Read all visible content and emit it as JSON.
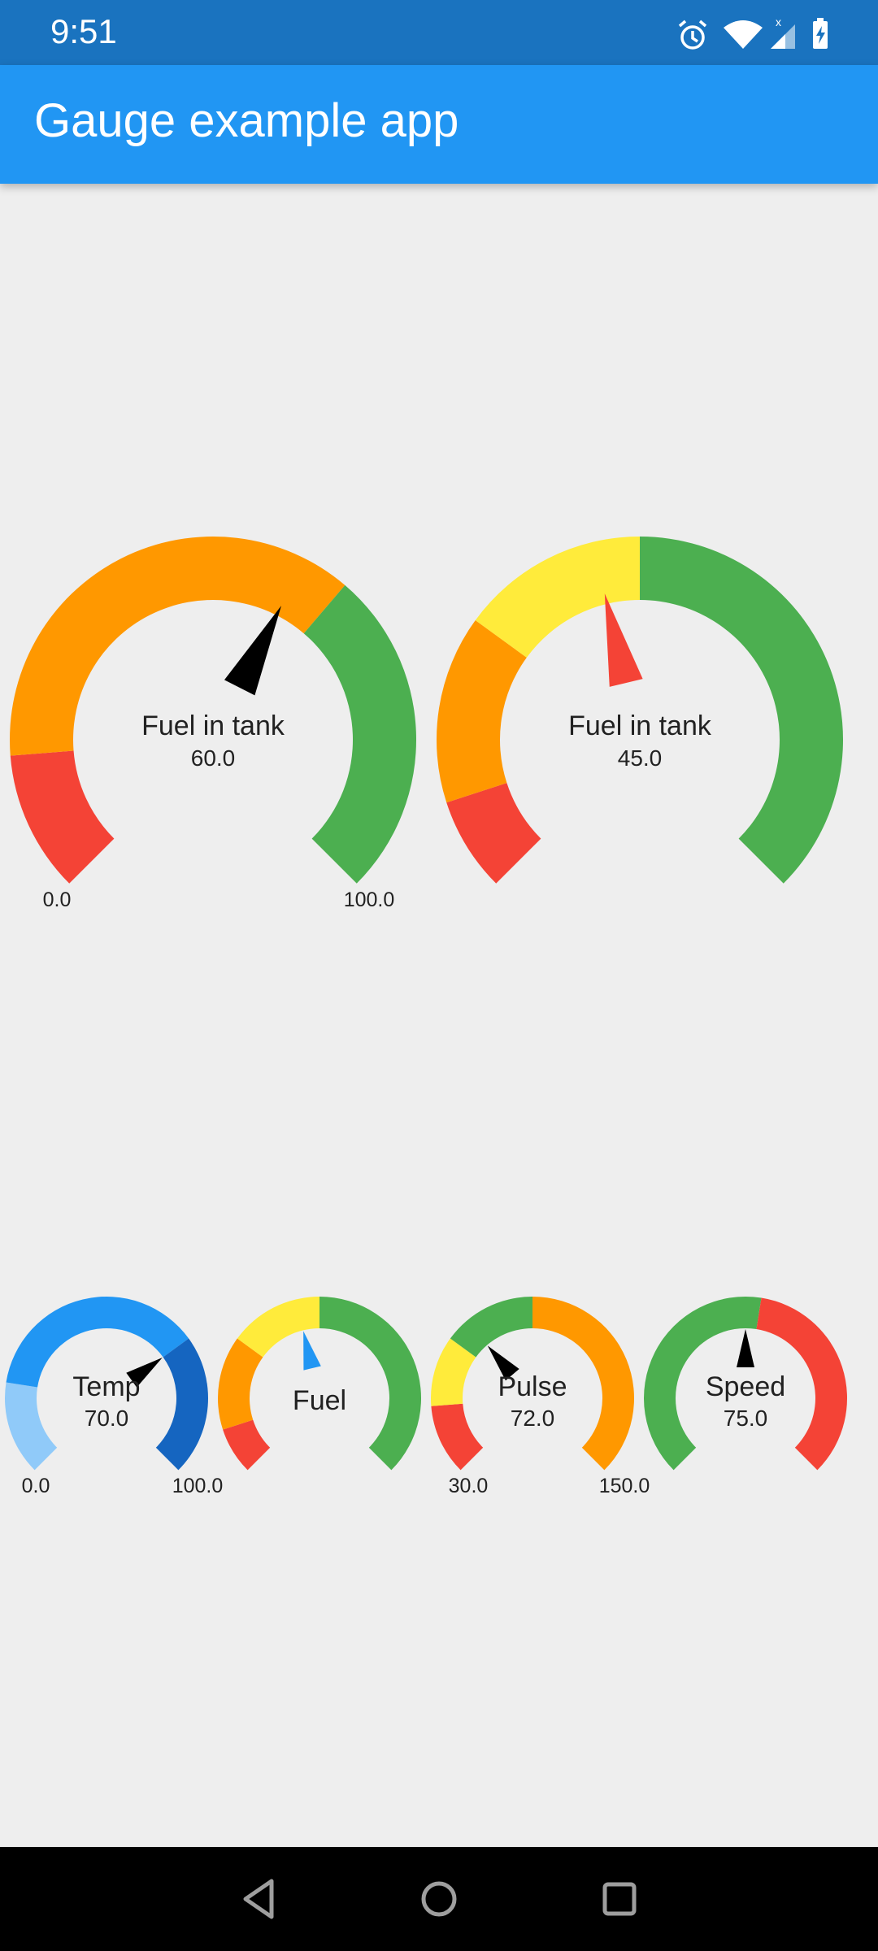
{
  "status_bar": {
    "time": "9:51",
    "icons": [
      "alarm-icon",
      "wifi-icon",
      "cell-signal-icon",
      "battery-charging-icon"
    ]
  },
  "app_bar": {
    "title": "Gauge example app"
  },
  "colors": {
    "red": "#f44336",
    "orange": "#ff9800",
    "yellow": "#ffeb3b",
    "green": "#4caf50",
    "blue": "#2196f3",
    "light_blue": "#90caf9",
    "dark_blue": "#1565c0",
    "needle_black": "#000000",
    "needle_red": "#f44336",
    "needle_blue": "#2196f3",
    "app_bar": "#2196f3",
    "status_bar": "#1a73bf",
    "background": "#eeeeee"
  },
  "gauges": [
    {
      "id": "fuel-large-1",
      "label": "Fuel in tank",
      "value": 60,
      "value_text": "60.0",
      "min": 0,
      "max": 100,
      "min_text": "0.0",
      "max_text": "100.0",
      "needle_color": "#000000",
      "segments": [
        {
          "from": 0,
          "to": 15,
          "color": "#f44336"
        },
        {
          "from": 15,
          "to": 65,
          "color": "#ff9800"
        },
        {
          "from": 65,
          "to": 100,
          "color": "#4caf50"
        }
      ]
    },
    {
      "id": "fuel-large-2",
      "label": "Fuel in tank",
      "value": 45,
      "value_text": "45.0",
      "min": 0,
      "max": 100,
      "min_text": "",
      "max_text": "",
      "needle_color": "#f44336",
      "segments": [
        {
          "from": 0,
          "to": 10,
          "color": "#f44336"
        },
        {
          "from": 10,
          "to": 30,
          "color": "#ff9800"
        },
        {
          "from": 30,
          "to": 50,
          "color": "#ffeb3b"
        },
        {
          "from": 50,
          "to": 100,
          "color": "#4caf50"
        }
      ]
    },
    {
      "id": "temp",
      "label": "Temp",
      "value": 70,
      "value_text": "70.0",
      "min": 0,
      "max": 100,
      "min_text": "0.0",
      "max_text": "100.0",
      "needle_color": "#000000",
      "segments": [
        {
          "from": 0,
          "to": 20,
          "color": "#90caf9"
        },
        {
          "from": 20,
          "to": 70,
          "color": "#2196f3"
        },
        {
          "from": 70,
          "to": 100,
          "color": "#1565c0"
        }
      ]
    },
    {
      "id": "fuel-small",
      "label": "Fuel",
      "value": 45,
      "value_text": "",
      "min": 0,
      "max": 100,
      "min_text": "",
      "max_text": "",
      "needle_color": "#2196f3",
      "segments": [
        {
          "from": 0,
          "to": 10,
          "color": "#f44336"
        },
        {
          "from": 10,
          "to": 30,
          "color": "#ff9800"
        },
        {
          "from": 30,
          "to": 50,
          "color": "#ffeb3b"
        },
        {
          "from": 50,
          "to": 100,
          "color": "#4caf50"
        }
      ]
    },
    {
      "id": "pulse",
      "label": "Pulse",
      "value": 72,
      "value_text": "72.0",
      "min": 30,
      "max": 150,
      "min_text": "30.0",
      "max_text": "150.0",
      "needle_color": "#000000",
      "segments": [
        {
          "from": 30,
          "to": 48,
          "color": "#f44336"
        },
        {
          "from": 48,
          "to": 66,
          "color": "#ffeb3b"
        },
        {
          "from": 66,
          "to": 90,
          "color": "#4caf50"
        },
        {
          "from": 90,
          "to": 150,
          "color": "#ff9800"
        }
      ]
    },
    {
      "id": "speed",
      "label": "Speed",
      "value": 75,
      "value_text": "75.0",
      "min": 0,
      "max": 150,
      "min_text": "",
      "max_text": "",
      "needle_color": "#000000",
      "segments": [
        {
          "from": 0,
          "to": 80,
          "color": "#4caf50"
        },
        {
          "from": 80,
          "to": 150,
          "color": "#f44336"
        }
      ]
    }
  ],
  "nav_bar": {
    "buttons": [
      "back-icon",
      "home-icon",
      "recents-icon"
    ]
  }
}
